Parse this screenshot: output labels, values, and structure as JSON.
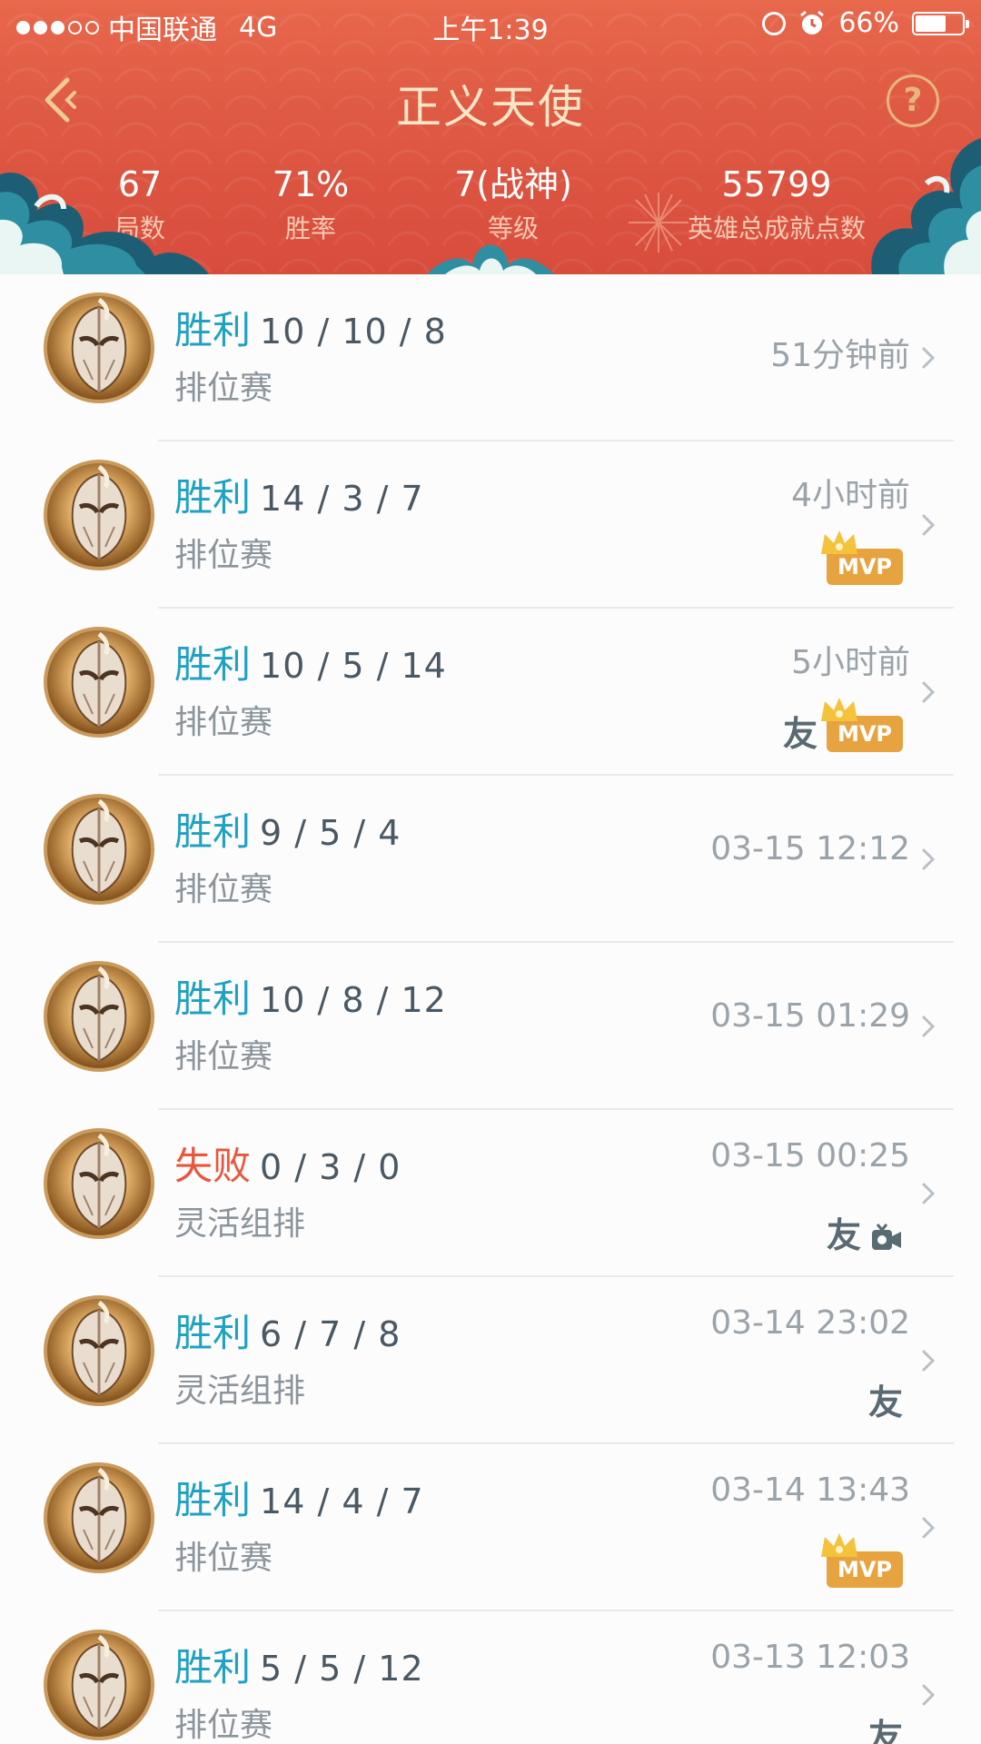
{
  "status_bar": {
    "carrier": "中国联通",
    "network": "4G",
    "time": "上午1:39",
    "battery": "66%",
    "battery_level": 0.66
  },
  "nav": {
    "title": "正义天使",
    "help_label": "?"
  },
  "stats": [
    {
      "value": "67",
      "label": "局数"
    },
    {
      "value": "71%",
      "label": "胜率"
    },
    {
      "value": "7(战神)",
      "label": "等级"
    },
    {
      "value": "55799",
      "label": "英雄总成就点数"
    }
  ],
  "matches": [
    {
      "result": "胜利",
      "win": true,
      "kda": "10 / 10 / 8",
      "mode": "排位赛",
      "time": "51分钟前",
      "mvp": false,
      "friend": false,
      "video": false
    },
    {
      "result": "胜利",
      "win": true,
      "kda": "14 / 3 / 7",
      "mode": "排位赛",
      "time": "4小时前",
      "mvp": true,
      "friend": false,
      "video": false
    },
    {
      "result": "胜利",
      "win": true,
      "kda": "10 / 5 / 14",
      "mode": "排位赛",
      "time": "5小时前",
      "mvp": true,
      "friend": true,
      "video": false
    },
    {
      "result": "胜利",
      "win": true,
      "kda": "9 / 5 / 4",
      "mode": "排位赛",
      "time": "03-15 12:12",
      "mvp": false,
      "friend": false,
      "video": false
    },
    {
      "result": "胜利",
      "win": true,
      "kda": "10 / 8 / 12",
      "mode": "排位赛",
      "time": "03-15 01:29",
      "mvp": false,
      "friend": false,
      "video": false
    },
    {
      "result": "失败",
      "win": false,
      "kda": "0 / 3 / 0",
      "mode": "灵活组排",
      "time": "03-15 00:25",
      "mvp": false,
      "friend": true,
      "video": true
    },
    {
      "result": "胜利",
      "win": true,
      "kda": "6 / 7 / 8",
      "mode": "灵活组排",
      "time": "03-14 23:02",
      "mvp": false,
      "friend": true,
      "video": false
    },
    {
      "result": "胜利",
      "win": true,
      "kda": "14 / 4 / 7",
      "mode": "排位赛",
      "time": "03-14 13:43",
      "mvp": true,
      "friend": false,
      "video": false
    },
    {
      "result": "胜利",
      "win": true,
      "kda": "5 / 5 / 12",
      "mode": "排位赛",
      "time": "03-13 12:03",
      "mvp": false,
      "friend": true,
      "video": false
    }
  ],
  "badges": {
    "mvp_label": "MVP",
    "friend_label": "友"
  },
  "colors": {
    "header_red": "#df5a44",
    "win": "#1fa1c2",
    "lose": "#e7573d",
    "mvp": "#e6a340",
    "title_gold": "#f8e6c7"
  },
  "icons": {
    "back": "chevron-left-icon",
    "help": "question-circle-icon",
    "row_chevron": "chevron-right-icon",
    "mvp": "mvp-crown-badge",
    "friend": "friend-badge",
    "video": "video-camera-icon",
    "lock_rotation": "rotation-lock-icon",
    "alarm": "alarm-icon"
  }
}
